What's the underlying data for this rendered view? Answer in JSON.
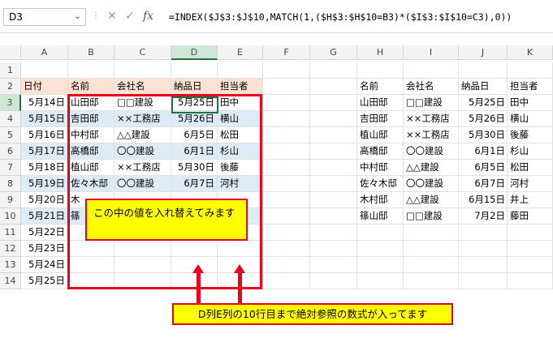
{
  "name_box": "D3",
  "formula_bar": {
    "cancel_icon": "✕",
    "enter_icon": "✓",
    "fx_label": "fx",
    "formula": "=INDEX($J$3:$J$10,MATCH(1,($H$3:$H$10=B3)*($I$3:$I$10=C3),0))"
  },
  "columns": [
    "A",
    "B",
    "C",
    "D",
    "E",
    "F",
    "G",
    "H",
    "I",
    "J",
    "K"
  ],
  "rows": [
    "1",
    "2",
    "3",
    "4",
    "5",
    "6",
    "7",
    "8",
    "9",
    "10",
    "11",
    "12",
    "13",
    "14"
  ],
  "left_table": {
    "headers": [
      "日付",
      "名前",
      "会社名",
      "納品日",
      "担当者"
    ],
    "rows": [
      [
        "5月14日",
        "山田邸",
        "□□建設",
        "5月25日",
        "田中"
      ],
      [
        "5月15日",
        "吉田邸",
        "××工務店",
        "5月26日",
        "横山"
      ],
      [
        "5月16日",
        "中村邸",
        "△△建設",
        "6月5日",
        "松田"
      ],
      [
        "5月17日",
        "高橋邸",
        "〇〇建設",
        "6月1日",
        "杉山"
      ],
      [
        "5月18日",
        "植山邸",
        "××工務店",
        "5月30日",
        "後藤"
      ],
      [
        "5月19日",
        "佐々木邸",
        "〇〇建設",
        "6月7日",
        "河村"
      ],
      [
        "5月20日",
        "木",
        "",
        "",
        ""
      ],
      [
        "5月21日",
        "篠",
        "",
        "",
        ""
      ],
      [
        "5月22日",
        "",
        "",
        "",
        ""
      ],
      [
        "5月23日",
        "",
        "",
        "",
        ""
      ],
      [
        "5月24日",
        "",
        "",
        "",
        ""
      ],
      [
        "5月25日",
        "",
        "",
        "",
        ""
      ]
    ]
  },
  "right_table": {
    "headers": [
      "名前",
      "会社名",
      "納品日",
      "担当者"
    ],
    "rows": [
      [
        "山田邸",
        "□□建設",
        "5月25日",
        "田中"
      ],
      [
        "吉田邸",
        "××工務店",
        "5月26日",
        "横山"
      ],
      [
        "植山邸",
        "××工務店",
        "5月30日",
        "後藤"
      ],
      [
        "高橋邸",
        "〇〇建設",
        "6月1日",
        "杉山"
      ],
      [
        "中村邸",
        "△△建設",
        "6月5日",
        "松田"
      ],
      [
        "佐々木邸",
        "〇〇建設",
        "6月7日",
        "河村"
      ],
      [
        "木村邸",
        "△△建設",
        "6月15日",
        "井上"
      ],
      [
        "篠山邸",
        "□□建設",
        "7月2日",
        "藤田"
      ]
    ]
  },
  "callout_1": "この中の値を入れ替えてみます",
  "callout_2": "D列E列の10行目まで絶対参照の数式が入ってます",
  "colors": {
    "header_bg": "#fbe2d5",
    "band_bg": "#ddebf7",
    "highlight": "#ffff00",
    "annotation_red": "#e8001c",
    "selection_green": "#217346"
  }
}
